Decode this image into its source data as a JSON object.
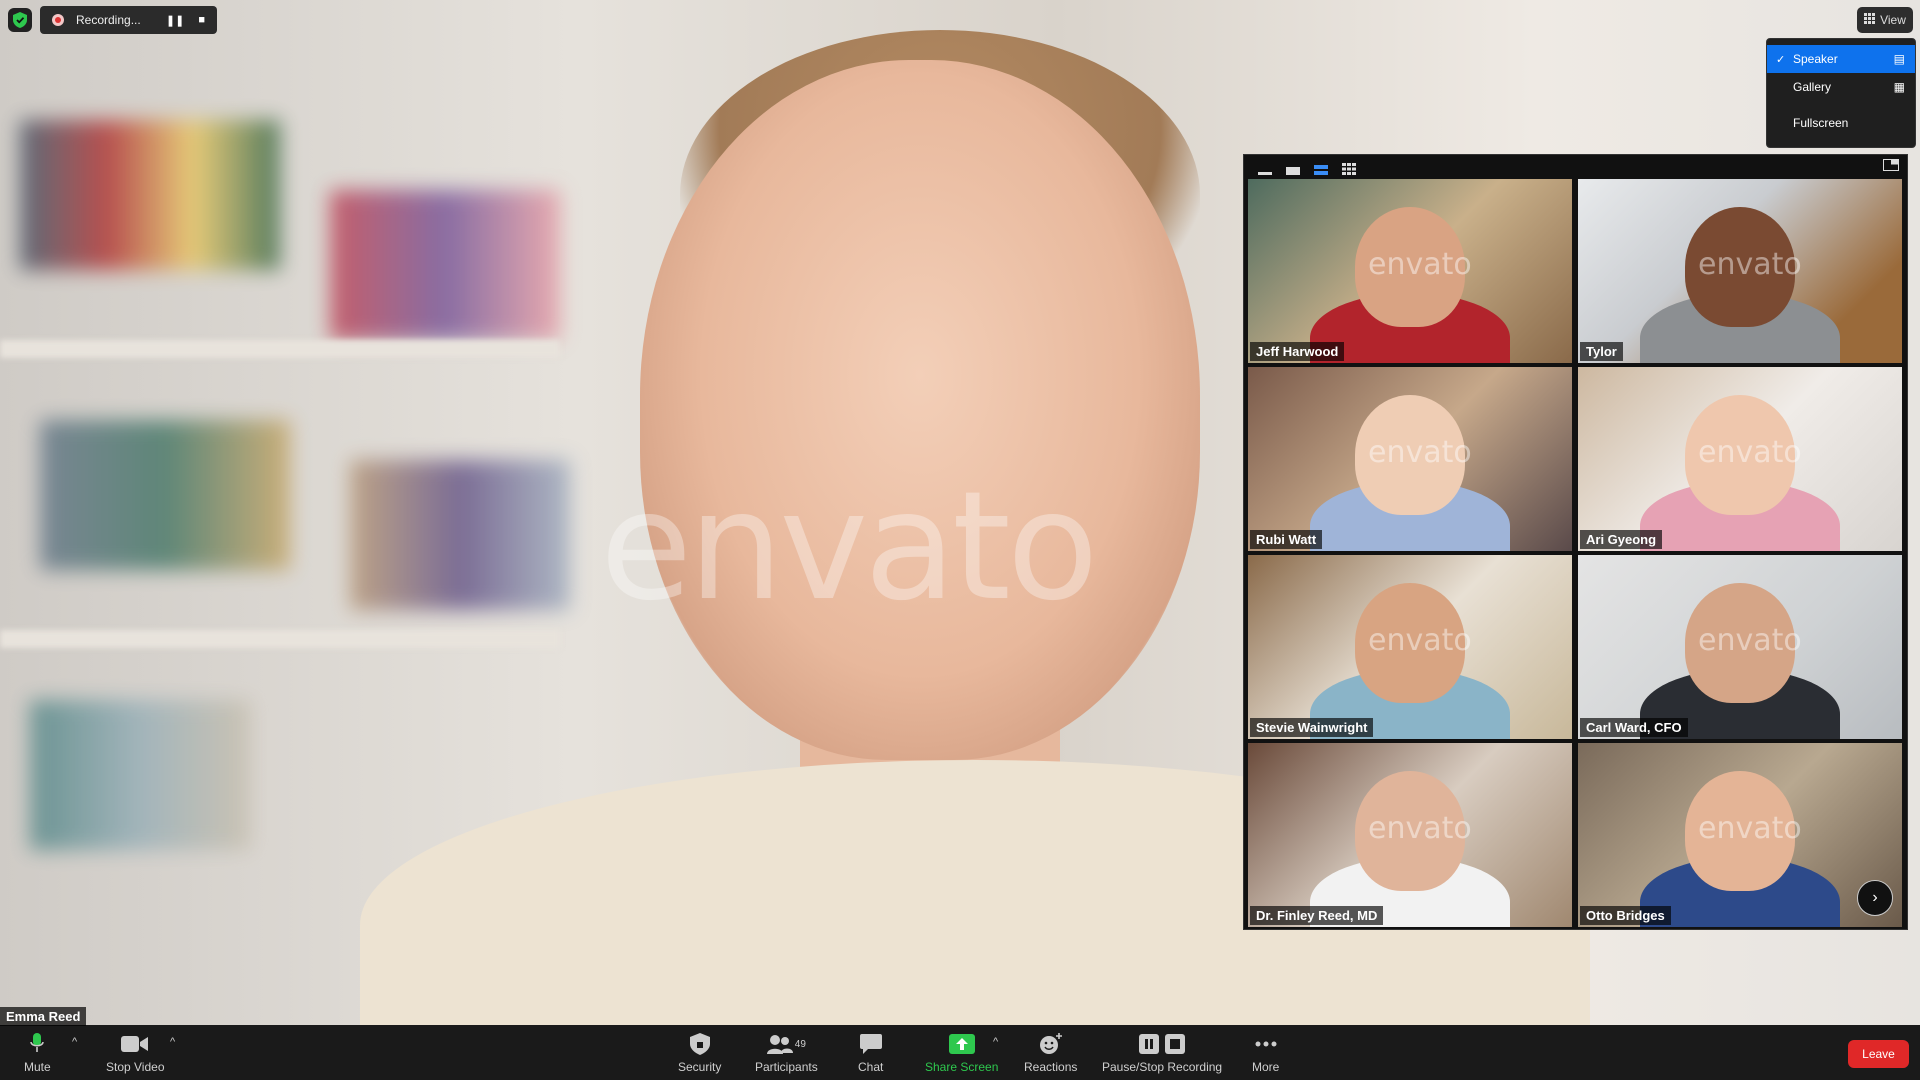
{
  "recording": {
    "label": "Recording..."
  },
  "view": {
    "button_label": "View",
    "menu": [
      {
        "label": "Speaker",
        "selected": true
      },
      {
        "label": "Gallery",
        "selected": false
      },
      {
        "label": "Fullscreen",
        "selected": false
      }
    ]
  },
  "speaker": {
    "name": "Emma Reed",
    "watermark": "envato"
  },
  "gallery": {
    "tiles": [
      {
        "name": "Jeff Harwood"
      },
      {
        "name": "Tylor"
      },
      {
        "name": "Rubi Watt"
      },
      {
        "name": "Ari Gyeong"
      },
      {
        "name": "Stevie Wainwright"
      },
      {
        "name": "Carl Ward, CFO"
      },
      {
        "name": "Dr. Finley Reed, MD"
      },
      {
        "name": "Otto Bridges"
      }
    ],
    "watermark": "envato"
  },
  "toolbar": {
    "mute": "Mute",
    "stop_video": "Stop Video",
    "security": "Security",
    "participants": "Participants",
    "participants_count": "49",
    "chat": "Chat",
    "share_screen": "Share Screen",
    "reactions": "Reactions",
    "pause_stop_recording": "Pause/Stop Recording",
    "more": "More",
    "leave": "Leave"
  },
  "colors": {
    "accent": "#0e72ed",
    "share_green": "#2ec84e",
    "leave_red": "#e02828"
  }
}
